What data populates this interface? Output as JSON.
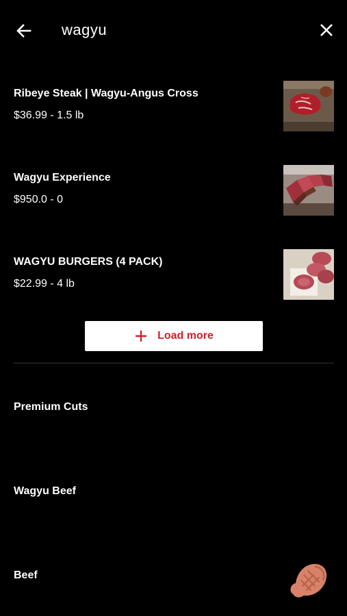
{
  "search": {
    "query": "wagyu"
  },
  "results": [
    {
      "name": "Ribeye Steak | Wagyu-Angus Cross",
      "price": "$36.99 - 1.5 lb",
      "image_icon": "ribeye-steak-image"
    },
    {
      "name": "Wagyu Experience",
      "price": "$950.0 - 0",
      "image_icon": "sliced-wagyu-image"
    },
    {
      "name": "WAGYU BURGERS (4 PACK)",
      "price": "$22.99 - 4 lb",
      "image_icon": "burger-patties-image"
    }
  ],
  "load_more": {
    "label": "Load more"
  },
  "categories": [
    {
      "label": "Premium Cuts"
    },
    {
      "label": "Wagyu Beef"
    },
    {
      "label": "Beef"
    }
  ],
  "colors": {
    "background": "#000000",
    "text": "#ffffff",
    "accent": "#d0202a",
    "fab": "#d9826a",
    "divider": "#333333"
  }
}
